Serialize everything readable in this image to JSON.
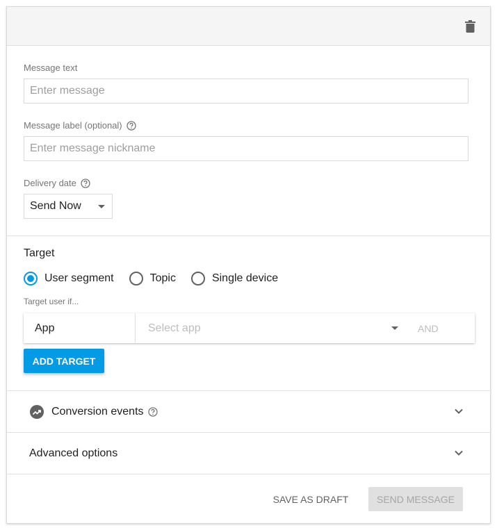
{
  "header": {
    "delete_icon": "trash-icon"
  },
  "message": {
    "text_label": "Message text",
    "text_placeholder": "Enter message",
    "text_value": "",
    "label_label": "Message label (optional)",
    "label_placeholder": "Enter message nickname",
    "label_value": ""
  },
  "delivery": {
    "label": "Delivery date",
    "selected": "Send Now"
  },
  "target": {
    "title": "Target",
    "options": [
      {
        "label": "User segment",
        "checked": true
      },
      {
        "label": "Topic",
        "checked": false
      },
      {
        "label": "Single device",
        "checked": false
      }
    ],
    "hint": "Target user if...",
    "row": {
      "type": "App",
      "select_placeholder": "Select app",
      "and_label": "AND"
    },
    "add_button": "ADD TARGET"
  },
  "sections": {
    "conversion_events": "Conversion events",
    "advanced_options": "Advanced options"
  },
  "footer": {
    "save_draft": "SAVE AS DRAFT",
    "send_message": "SEND MESSAGE"
  },
  "colors": {
    "accent": "#039be5",
    "header_bg": "#f5f5f5",
    "disabled_bg": "#e0e0e0",
    "disabled_text": "#a6a6a6"
  }
}
